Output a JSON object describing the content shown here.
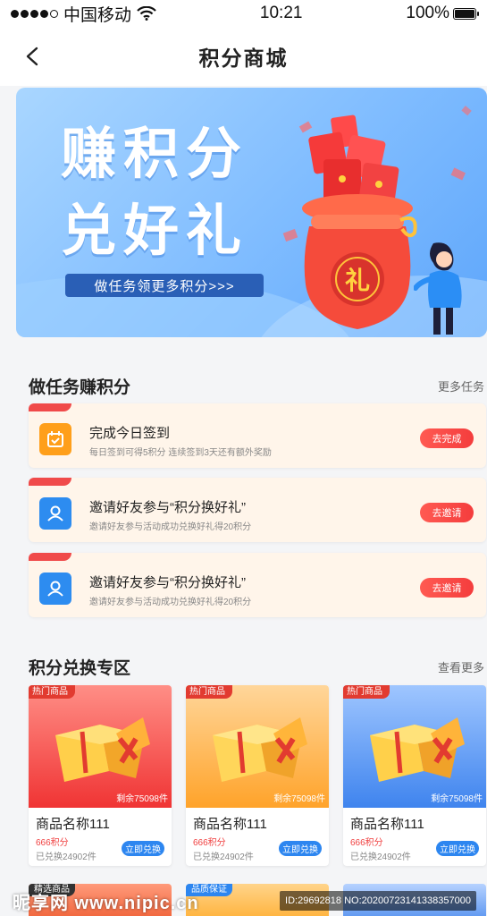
{
  "status_bar": {
    "carrier": "中国移动",
    "time": "10:21",
    "battery": "100%"
  },
  "nav": {
    "title": "积分商城"
  },
  "banner": {
    "line1": "赚积分",
    "line2": "兑好礼",
    "cta": "做任务领更多积分>>>",
    "bag_char": "礼"
  },
  "tasks_section": {
    "title": "做任务赚积分",
    "more": "更多任务"
  },
  "tasks": [
    {
      "title": "完成今日签到",
      "desc": "每日签到可得5积分  连续签到3天还有额外奖励",
      "button": "去完成",
      "icon": "calendar-check-icon"
    },
    {
      "title": "邀请好友参与“积分换好礼”",
      "desc": "邀请好友参与活动成功兑换好礼得20积分",
      "button": "去邀请",
      "icon": "user-icon"
    },
    {
      "title": "邀请好友参与“积分换好礼”",
      "desc": "邀请好友参与活动成功兑换好礼得20积分",
      "button": "去邀请",
      "icon": "user-icon"
    }
  ],
  "exchange_section": {
    "title": "积分兑换专区",
    "more": "查看更多"
  },
  "products": [
    {
      "tag": "热门商品",
      "remaining": "剩余75098件",
      "name": "商品名称111",
      "points": "666积分",
      "sold": "已兑换24902件",
      "button": "立即兑换",
      "theme": "red"
    },
    {
      "tag": "热门商品",
      "remaining": "剩余75098件",
      "name": "商品名称111",
      "points": "666积分",
      "sold": "已兑换24902件",
      "button": "立即兑换",
      "theme": "orange"
    },
    {
      "tag": "热门商品",
      "remaining": "剩余75098件",
      "name": "商品名称111",
      "points": "666积分",
      "sold": "已兑换24902件",
      "button": "立即兑换",
      "theme": "blue"
    }
  ],
  "bottom_cards": [
    {
      "tag": "精选商品"
    },
    {
      "tag": "品质保证"
    },
    {
      "tag": ""
    }
  ],
  "watermark": {
    "logo": "昵享网 www.nipic.cn",
    "id": "ID:29692818 NO:20200723141338357000"
  },
  "colors": {
    "accent_red": "#f04a4a",
    "accent_blue": "#2d86f0",
    "task_bg": "#fff5ea"
  }
}
